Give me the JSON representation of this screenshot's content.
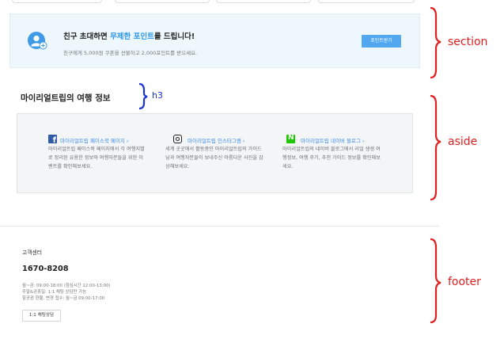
{
  "banner": {
    "title_before": "친구 초대하면 ",
    "title_highlight": "무제한 포인트",
    "title_after": "를 드립니다!",
    "description": "친구에게 5,000원 쿠폰을 선물하고 2,000포인트를 받으세요.",
    "button_label": "포인트받기",
    "accent_color": "#2b96ed"
  },
  "info_section": {
    "heading": "마이리얼트립의 여행 정보",
    "columns": [
      {
        "icon": "facebook-icon",
        "link": "마이리얼트립 페이스북 페이지 ›",
        "description": "마이리얼트립 페이스북 페이지에서 각 여행지별로 정리된 유용한 정보와 여행자분들을 위한 이벤트를 확인해보세요."
      },
      {
        "icon": "instagram-icon",
        "link": "마이리얼트립 인스타그램 ›",
        "description": "세계 곳곳에서 활동중인 마이리얼트립의 가이드님과 여행자분들이 보내주신 아름다운 사진을 감상해보세요."
      },
      {
        "icon": "naver-blog-icon",
        "link": "마이리얼트립 네이버 블로그 ›",
        "description": "마이리얼트립의 네이버 블로그에서 리얼 생생 여행정보, 여행 후기, 추천 가이드 정보를 확인해보세요."
      }
    ]
  },
  "footer": {
    "label": "고객센터",
    "phone": "1670-8208",
    "hours": [
      "월~금: 09:00-18:00 (점심시간 12:00-13:00)",
      "주말&공휴일: 1:1 채팅 상담만 가능",
      "항공권 환불, 변경 접수: 월~금 09:00-17:00"
    ],
    "chat_button": "1:1 채팅상담"
  },
  "annotations": {
    "section": "section",
    "h3": "h3",
    "aside": "aside",
    "footer": "footer",
    "label_color": "#e02020",
    "h3_color": "#1a35d6"
  }
}
